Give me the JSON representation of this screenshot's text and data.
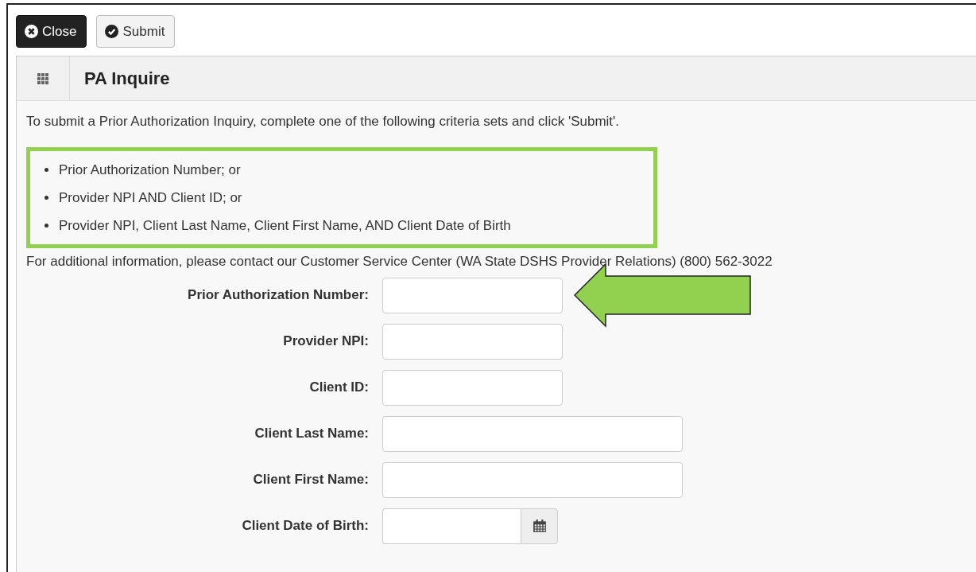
{
  "toolbar": {
    "buttons": [
      {
        "label": "Close",
        "kind": "close"
      },
      {
        "label": "Submit",
        "kind": "submit"
      }
    ]
  },
  "panel": {
    "title": "PA Inquire",
    "intro": "To submit a Prior Authorization Inquiry, complete one of the following criteria sets and click 'Submit'.",
    "criteria": [
      "Prior Authorization Number; or",
      "Provider NPI AND Client ID; or",
      "Provider NPI, Client Last Name, Client First Name, AND Client Date of Birth"
    ],
    "contact": "For additional information, please contact our Customer Service Center (WA State DSHS Provider Relations) (800) 562-3022",
    "fields": [
      {
        "label": "Prior Authorization Number:",
        "kind": "short",
        "pointed": true
      },
      {
        "label": "Provider NPI:",
        "kind": "short",
        "pointed": false
      },
      {
        "label": "Client ID:",
        "kind": "short",
        "pointed": false
      },
      {
        "label": "Client Last Name:",
        "kind": "long",
        "pointed": false
      },
      {
        "label": "Client First Name:",
        "kind": "long",
        "pointed": false
      },
      {
        "label": "Client Date of Birth:",
        "kind": "date",
        "pointed": false
      }
    ]
  }
}
